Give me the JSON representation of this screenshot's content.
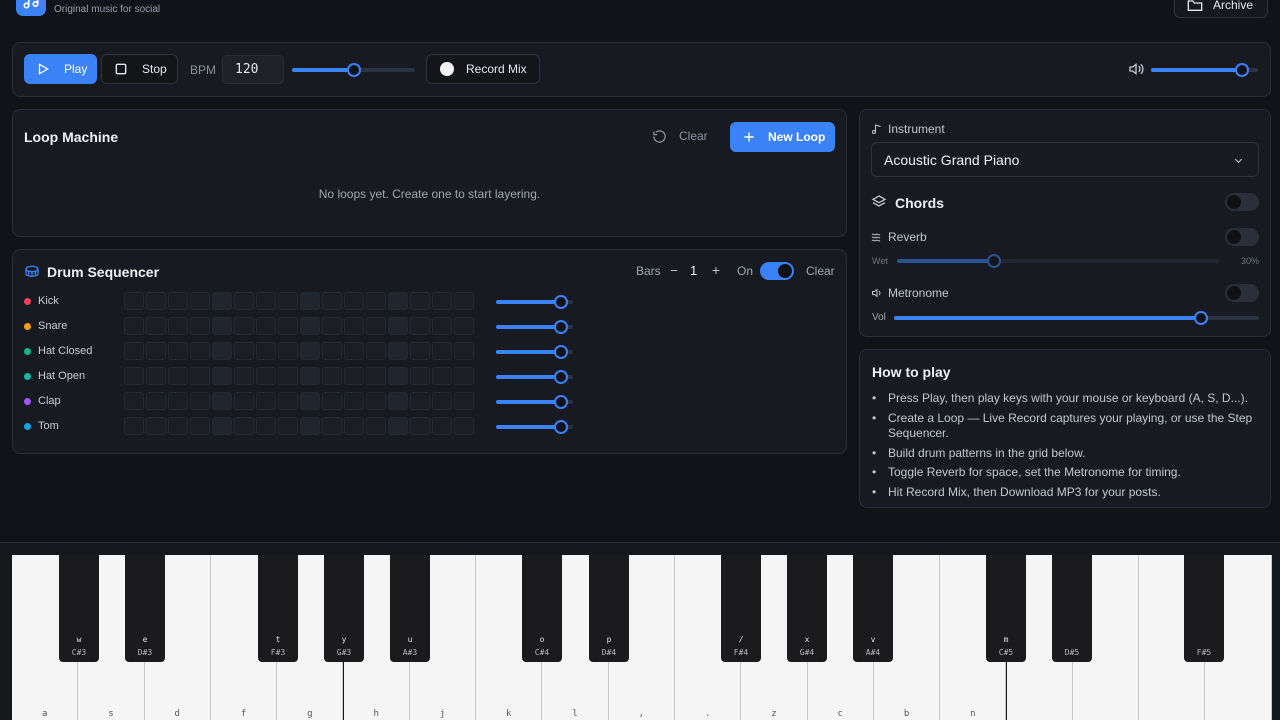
{
  "header": {
    "subtitle": "Original music for social",
    "archive_label": "Archive"
  },
  "transport": {
    "play_label": "Play",
    "stop_label": "Stop",
    "bpm_label": "BPM",
    "bpm_value": "120",
    "bpm_slider_level": 0.5,
    "record_label": "Record Mix",
    "volume_level": 0.85
  },
  "loop_machine": {
    "title": "Loop Machine",
    "clear_label": "Clear",
    "new_loop_label": "New Loop",
    "empty_message": "No loops yet. Create one to start layering."
  },
  "drum": {
    "title": "Drum Sequencer",
    "bars_label": "Bars",
    "bars_value": "1",
    "minus": "−",
    "plus": "+",
    "on_label": "On",
    "clear_label": "Clear",
    "tracks": [
      {
        "name": "Kick",
        "color": "#f43f5e",
        "level": 0.85
      },
      {
        "name": "Snare",
        "color": "#f59e0b",
        "level": 0.85
      },
      {
        "name": "Hat Closed",
        "color": "#10b981",
        "level": 0.85
      },
      {
        "name": "Hat Open",
        "color": "#14b8a6",
        "level": 0.85
      },
      {
        "name": "Clap",
        "color": "#a855f7",
        "level": 0.85
      },
      {
        "name": "Tom",
        "color": "#0ea5e9",
        "level": 0.85
      }
    ]
  },
  "instrument": {
    "label": "Instrument",
    "selected": "Acoustic Grand Piano",
    "chords_label": "Chords",
    "reverb_label": "Reverb",
    "wet_label": "Wet",
    "wet_value": "30%",
    "wet_level": 0.3,
    "metronome_label": "Metronome",
    "vol_label": "Vol",
    "vol_level": 0.84
  },
  "howto": {
    "title": "How to play",
    "items": [
      "Press Play, then play keys with your mouse or keyboard (A, S, D...).",
      "Create a Loop — Live Record captures your playing, or use the Step Sequencer.",
      "Build drum patterns in the grid below.",
      "Toggle Reverb for space, set the Metronome for timing.",
      "Hit Record Mix, then Download MP3 for your posts."
    ]
  },
  "piano": {
    "white_keys": [
      "a",
      "s",
      "d",
      "f",
      "g",
      "h",
      "j",
      "k",
      "l",
      ",",
      ".",
      "z",
      "c",
      "b",
      "n",
      "",
      "",
      "",
      ""
    ],
    "black_keys": [
      {
        "key": "w",
        "note": "C#3"
      },
      {
        "key": "e",
        "note": "D#3"
      },
      {
        "key": "t",
        "note": "F#3"
      },
      {
        "key": "y",
        "note": "G#3"
      },
      {
        "key": "u",
        "note": "A#3"
      },
      {
        "key": "o",
        "note": "C#4"
      },
      {
        "key": "p",
        "note": "D#4"
      },
      {
        "key": "/",
        "note": "F#4"
      },
      {
        "key": "x",
        "note": "G#4"
      },
      {
        "key": "v",
        "note": "A#4"
      },
      {
        "key": "m",
        "note": "C#5"
      },
      {
        "key": "",
        "note": "D#5"
      },
      {
        "key": "",
        "note": "F#5"
      }
    ]
  }
}
